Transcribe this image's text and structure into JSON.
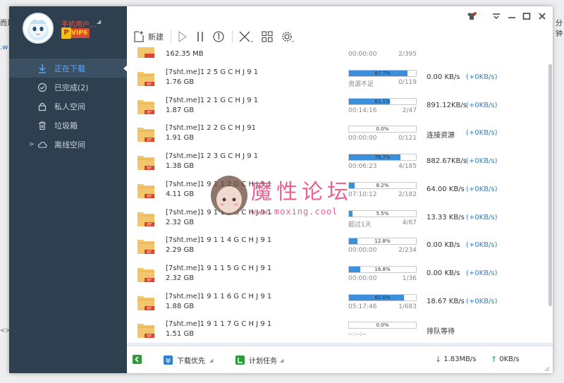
{
  "outside": {
    "left_text": "而是",
    "left_link": ".w",
    "right_text": "分钟",
    "bottom_left": "<>"
  },
  "user": {
    "name": "手机用户...",
    "vip": "VIP6",
    "vip_badge": "P"
  },
  "nav": [
    {
      "label": "正在下载",
      "icon": "download-icon",
      "active": true
    },
    {
      "label": "已完成(2)",
      "icon": "check-circle-icon",
      "active": false
    },
    {
      "label": "私人空间",
      "icon": "lock-icon",
      "active": false
    },
    {
      "label": "垃圾箱",
      "icon": "trash-icon",
      "active": false
    },
    {
      "label": "离线空间",
      "icon": "cloud-icon",
      "active": false
    }
  ],
  "toolbar": {
    "new_label": "新建"
  },
  "partial_row": {
    "size": "162.35 MB",
    "time": "00:00:00",
    "conn": "2/395"
  },
  "downloads": [
    {
      "name": "[7sht.me]1 2 5 G C H J 9 1",
      "size": "1.76 GB",
      "progress": 87.7,
      "progress_label": "87.7%",
      "time": "资源不足",
      "conn": "0/119",
      "speed": "0.00   KB/s",
      "up": "(+0KB/s)"
    },
    {
      "name": "[7sht.me]1 2 1 G C H J 9 1",
      "size": "1.87 GB",
      "progress": 61.1,
      "progress_label": "61.1%",
      "time": "00:14:16",
      "conn": "2/47",
      "speed": "891.12KB/s",
      "up": "(+0KB/s)"
    },
    {
      "name": "[7sht.me]1 2 2 G C H J 91",
      "size": "1.91 GB",
      "progress": 0.0,
      "progress_label": "0.0%",
      "time": "00:00:00",
      "conn": "0/121",
      "speed": "连接资源",
      "up": "(+0KB/s)"
    },
    {
      "name": "[7sht.me]1 2 3 G C H J 9 1",
      "size": "1.38 GB",
      "progress": 76.7,
      "progress_label": "76.7%",
      "time": "00:06:23",
      "conn": "4/185",
      "speed": "882.67KB/s",
      "up": "(+0KB/s)"
    },
    {
      "name": "[7sht.me]1 9 1 1 2 G C H J 9 1",
      "size": "4.11 GB",
      "progress": 8.2,
      "progress_label": "8.2%",
      "time": "07:10:12",
      "conn": "2/182",
      "speed": "64.00  KB/s",
      "up": "(+0KB/s)"
    },
    {
      "name": "[7sht.me]1 9 1 1 3 G C H J 9 1",
      "size": "2.32 GB",
      "progress": 5.5,
      "progress_label": "5.5%",
      "time": "超过1天",
      "conn": "4/87",
      "speed": "13.33  KB/s",
      "up": "(+0KB/s)"
    },
    {
      "name": "[7sht.me]1 9 1 1 4 G C H J 9 1",
      "size": "2.29 GB",
      "progress": 12.8,
      "progress_label": "12.8%",
      "time": "00:00:00",
      "conn": "2/234",
      "speed": "0.00   KB/s",
      "up": "(+0KB/s)"
    },
    {
      "name": "[7sht.me]1 9 1 1 5 G C H J 9 1",
      "size": "2.32 GB",
      "progress": 16.8,
      "progress_label": "16.8%",
      "time": "00:00:00",
      "conn": "1/36",
      "speed": "0.00   KB/s",
      "up": "(+0KB/s)"
    },
    {
      "name": "[7sht.me]1 9 1 1 6 G C H J 9 1",
      "size": "1.88 GB",
      "progress": 82.0,
      "progress_label": "82.0%",
      "time": "05:17:46",
      "conn": "1/683",
      "speed": "18.67  KB/s",
      "up": "(+0KB/s)"
    },
    {
      "name": "[7sht.me]1 9 1 1 7 G C H J 9 1",
      "size": "1.51 GB",
      "progress": 0.0,
      "progress_label": "0.0%",
      "time": "--:--:--",
      "conn": "",
      "speed": "排队等待",
      "up": ""
    }
  ],
  "statusbar": {
    "priority_label": "下载优先",
    "schedule_label": "计划任务",
    "down_speed": "1.83MB/s",
    "up_speed": "0KB/s"
  },
  "watermark": {
    "title": "魔性论坛",
    "url": "www.moxing.cool"
  },
  "colors": {
    "accent": "#3b8fdc",
    "sidebar": "#2e3f4f",
    "vip": "#d94a3b"
  }
}
